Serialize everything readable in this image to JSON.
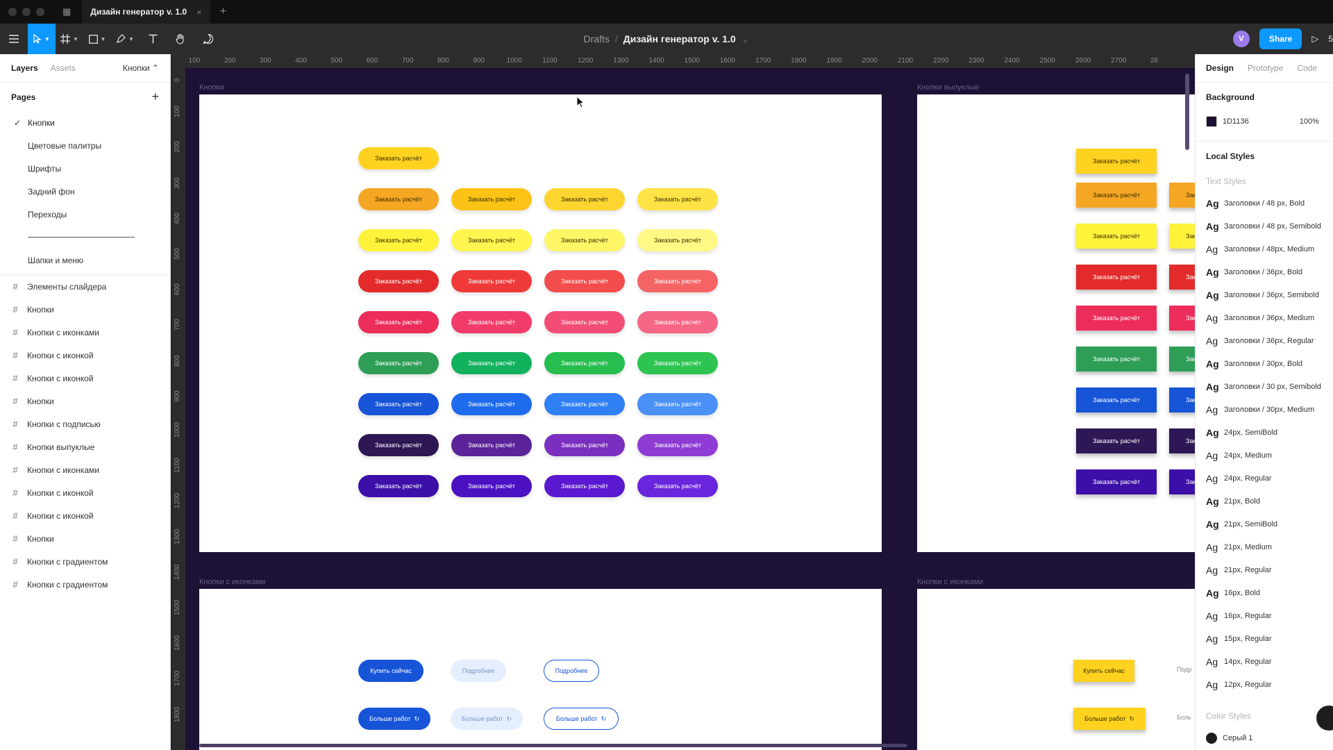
{
  "window": {
    "tab_title": "Дизайн генератор v. 1.0",
    "tab_close": "×",
    "tab_add": "+"
  },
  "toolbar": {
    "breadcrumb_root": "Drafts",
    "breadcrumb_sep": "/",
    "file_name": "Дизайн генератор v. 1.0",
    "file_caret": "⌄",
    "avatar_letter": "V",
    "share_label": "Share",
    "present_icon": "▷",
    "zoom_partial": "5"
  },
  "left_panel": {
    "tab_layers": "Layers",
    "tab_assets": "Assets",
    "page_selector": "Кнопки ⌃",
    "pages_header": "Pages",
    "pages_add": "+",
    "pages": [
      {
        "label": "Кнопки",
        "current": true
      },
      {
        "label": "Цветовые палитры"
      },
      {
        "label": "Шрифты"
      },
      {
        "label": "Задний фон"
      },
      {
        "label": "Переходы"
      },
      {
        "label": "Шапки и меню"
      }
    ],
    "layers": [
      "Элементы слайдера",
      "Кнопки",
      "Кнопки с иконками",
      "Кнопки с иконкой",
      "Кнопки с иконкой",
      "Кнопки",
      "Кнопки с подписью",
      "Кнопки выпуклые",
      "Кнопки с иконками",
      "Кнопки с иконкой",
      "Кнопки с иконкой",
      "Кнопки",
      "Кнопки с градиентом",
      "Кнопки с градиентом"
    ]
  },
  "canvas": {
    "background": "#1d1136",
    "ruler_top": [
      "100",
      "200",
      "300",
      "400",
      "500",
      "600",
      "700",
      "800",
      "900",
      "1000",
      "1100",
      "1200",
      "1300",
      "1400",
      "1500",
      "1600",
      "1700",
      "1800",
      "1900",
      "2000",
      "2100",
      "2200",
      "2300",
      "2400",
      "2500",
      "2600",
      "2700",
      "28"
    ],
    "ruler_left": [
      "0",
      "100",
      "200",
      "300",
      "400",
      "500",
      "600",
      "700",
      "800",
      "900",
      "1000",
      "1100",
      "1200",
      "1300",
      "1400",
      "1500",
      "1600",
      "1700",
      "1800"
    ],
    "frames": {
      "buttons_label": "Кнопки",
      "convex_label": "Кнопки выпуклые",
      "icons_label_1": "Кнопки с иконками",
      "icons_label_2": "Кнопки с иконками"
    },
    "button_text": "Заказать расчёт",
    "button_rows": [
      [
        "#ffd21f",
        "#ffd21f",
        "#ffd21f",
        "#ffd21f"
      ],
      [
        "#f5a623",
        "#fbc315",
        "#fdd530",
        "#ffe246"
      ],
      [
        "#fff23b",
        "#fff550",
        "#fff667",
        "#fff884"
      ],
      [
        "#e32b2b",
        "#f03a3a",
        "#f34c4c",
        "#f56464"
      ],
      [
        "#ec2d5a",
        "#f13c69",
        "#f34d75",
        "#f66685"
      ],
      [
        "#2e9e57",
        "#12b15e",
        "#25be4f",
        "#2ec451"
      ],
      [
        "#1654d8",
        "#1e6bed",
        "#2f80f5",
        "#4a90f7"
      ],
      [
        "#2e1755",
        "#5a2398",
        "#7a2fc0",
        "#8e3cd4"
      ],
      [
        "#3c0fa8",
        "#4a10c2",
        "#5a18d0",
        "#6a26dc"
      ]
    ],
    "button_text_colors": [
      "#3b2f00",
      "#3b2f00",
      "#3b2f00",
      "#ffffff",
      "#ffffff",
      "#ffffff",
      "#ffffff",
      "#ffffff",
      "#ffffff"
    ],
    "convex_rows": [
      "#ffd21f",
      "#f5a623",
      "#fff23b",
      "#e32b2b",
      "#ec2d5a",
      "#2e9e57",
      "#1654d8",
      "#2e1755",
      "#3c0fa8"
    ],
    "icon_buttons": {
      "buy_now": "Купить сейчас",
      "more": "Подробнее",
      "more_works": "Больше работ",
      "convex_buy_now": "Купить сейчас",
      "convex_more_works": "Больше работ",
      "cut_more": "Подр",
      "cut_more_works": "Боль"
    }
  },
  "right_panel": {
    "tab_design": "Design",
    "tab_prototype": "Prototype",
    "tab_code": "Code",
    "background_header": "Background",
    "background_hex": "1D1136",
    "background_swatch": "#1d1136",
    "background_opacity": "100%",
    "local_styles_header": "Local Styles",
    "text_styles_header": "Text Styles",
    "text_styles": [
      "Заголовки / 48 px, Bold",
      "Заголовки / 48 px, Semibold",
      "Заголовки / 48px, Medium",
      "Заголовки / 36px, Bold",
      "Заголовки / 36px, Semibold",
      "Заголовки / 36px, Medium",
      "Заголовки / 36px, Regular",
      "Заголовки / 30px, Bold",
      "Заголовки / 30 px, Semibold",
      "Заголовки / 30px, Medium",
      "24px, SemiBold",
      "24px, Medium",
      "24px, Regular",
      "21px, Bold",
      "21px, SemiBold",
      "21px, Medium",
      "21px, Regular",
      "16px, Bold",
      "16px, Regular",
      "15px, Regular",
      "14px, Regular",
      "12px, Regular"
    ],
    "ag_label": "Ag",
    "color_styles_header": "Color Styles",
    "color_style_1": "Серый 1"
  }
}
